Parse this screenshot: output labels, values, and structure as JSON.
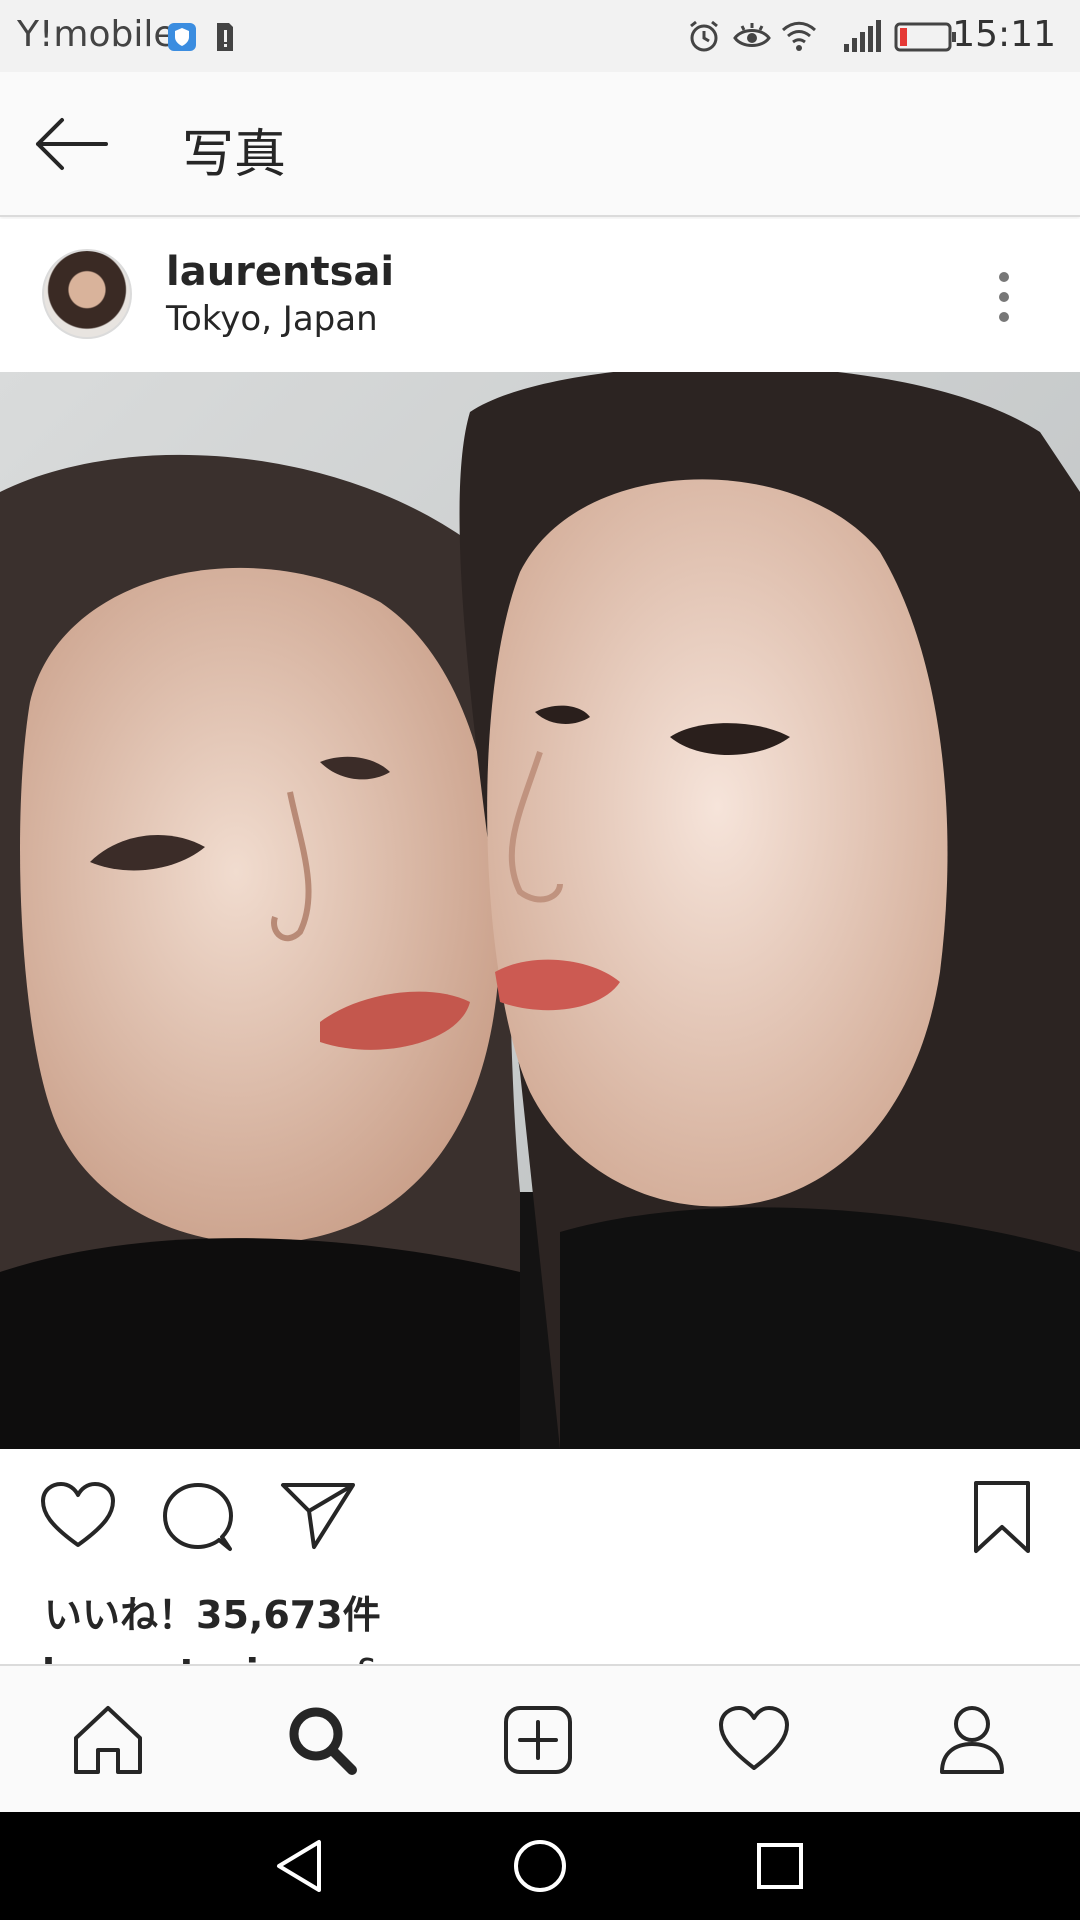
{
  "status_bar": {
    "carrier": "Y!mobile",
    "time": "15:11",
    "icons": [
      "shield-icon",
      "sim-alert-icon",
      "alarm-icon",
      "eye-icon",
      "wifi-icon",
      "signal-icon",
      "battery-low-icon"
    ],
    "battery_color": "#e53935"
  },
  "app_bar": {
    "title": "写真",
    "back_icon": "arrow-left-icon"
  },
  "post": {
    "username": "laurentsai",
    "location": "Tokyo, Japan",
    "more_icon": "more-vertical-icon",
    "photo_alt": "Two women posing cheek to cheek",
    "likes": "いいね！35,673件",
    "caption_user": "laurentsai",
    "caption_text": "you & me"
  },
  "actions": {
    "icons": [
      "heart-icon",
      "comment-icon",
      "share-icon",
      "bookmark-icon"
    ]
  },
  "bottom_nav": {
    "items": [
      "home-icon",
      "search-icon",
      "add-post-icon",
      "activity-heart-icon",
      "profile-icon"
    ],
    "active": "search-icon"
  },
  "system_nav": {
    "items": [
      "back-triangle-icon",
      "home-circle-icon",
      "recents-square-icon"
    ]
  }
}
